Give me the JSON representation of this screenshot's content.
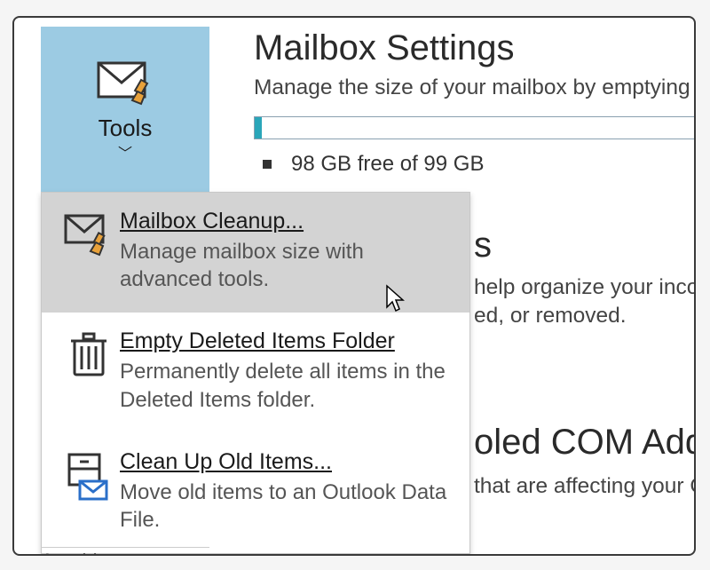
{
  "tools_button": {
    "label": "Tools"
  },
  "page": {
    "title": "Mailbox Settings",
    "subtitle": "Manage the size of your mailbox by emptying ",
    "storage_text": "98 GB free of 99 GB"
  },
  "bg": {
    "rules_s": "s",
    "rules_line1": "help organize your inco",
    "rules_line2": "ed, or removed.",
    "addins_title": "oled COM Add-",
    "addins_line": "that are affecting your O"
  },
  "menu": {
    "items": [
      {
        "title": "Mailbox Cleanup...",
        "desc": "Manage mailbox size with advanced tools."
      },
      {
        "title": "Empty Deleted Items Folder",
        "desc": "Permanently delete all items in the Deleted Items folder."
      },
      {
        "title": "Clean Up Old Items...",
        "desc": "Move old items to an Outlook Data File."
      }
    ]
  },
  "sidebar": {
    "addins_stub": "Auu-iris"
  }
}
